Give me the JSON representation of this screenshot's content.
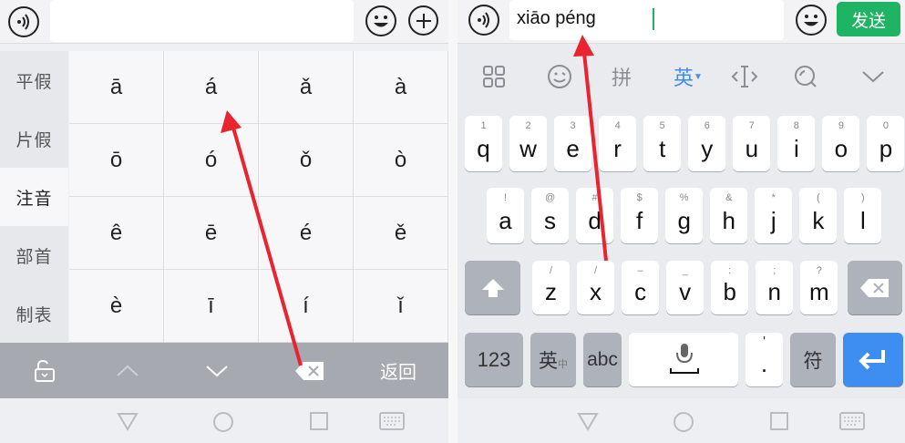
{
  "left": {
    "sidebar": {
      "items": [
        "平假",
        "片假",
        "注音",
        "部首",
        "制表"
      ],
      "active_index": 2
    },
    "grid": {
      "cells": [
        "ā",
        "á",
        "ǎ",
        "à",
        "ō",
        "ó",
        "ǒ",
        "ò",
        "ê",
        "ē",
        "é",
        "ě",
        "è",
        "ī",
        "í",
        "ǐ"
      ]
    },
    "bottom": {
      "return_label": "返回"
    }
  },
  "right": {
    "input_value": "xiāo péng",
    "send_label": "发送",
    "toolbar": {
      "pinyin_label": "拼",
      "english_label": "英"
    },
    "rows": [
      [
        {
          "k": "q",
          "h": "1"
        },
        {
          "k": "w",
          "h": "2"
        },
        {
          "k": "e",
          "h": "3"
        },
        {
          "k": "r",
          "h": "4"
        },
        {
          "k": "t",
          "h": "5"
        },
        {
          "k": "y",
          "h": "6"
        },
        {
          "k": "u",
          "h": "7"
        },
        {
          "k": "i",
          "h": "8"
        },
        {
          "k": "o",
          "h": "9"
        },
        {
          "k": "p",
          "h": "0"
        }
      ],
      [
        {
          "k": "a",
          "h": "!"
        },
        {
          "k": "s",
          "h": "@"
        },
        {
          "k": "d",
          "h": "#"
        },
        {
          "k": "f",
          "h": "$"
        },
        {
          "k": "g",
          "h": "%"
        },
        {
          "k": "h",
          "h": "&"
        },
        {
          "k": "j",
          "h": "*"
        },
        {
          "k": "k",
          "h": "("
        },
        {
          "k": "l",
          "h": ")"
        }
      ],
      [
        {
          "k": "z",
          "h": "/"
        },
        {
          "k": "x",
          "h": "/"
        },
        {
          "k": "c",
          "h": "–"
        },
        {
          "k": "v",
          "h": "_"
        },
        {
          "k": "b",
          "h": ":"
        },
        {
          "k": "n",
          "h": ";"
        },
        {
          "k": "m",
          "h": "?"
        }
      ]
    ],
    "bottom_row": {
      "num_label": "123",
      "lang_label": "英",
      "lang_sub": "中",
      "abc_label": "abc",
      "period_label": ".",
      "period_hint": "'",
      "symbol_label": "符"
    }
  },
  "colors": {
    "send": "#1fb463",
    "enter": "#3d8ef0",
    "arrow": "#e8252f",
    "tool_active": "#3d8ef0"
  }
}
